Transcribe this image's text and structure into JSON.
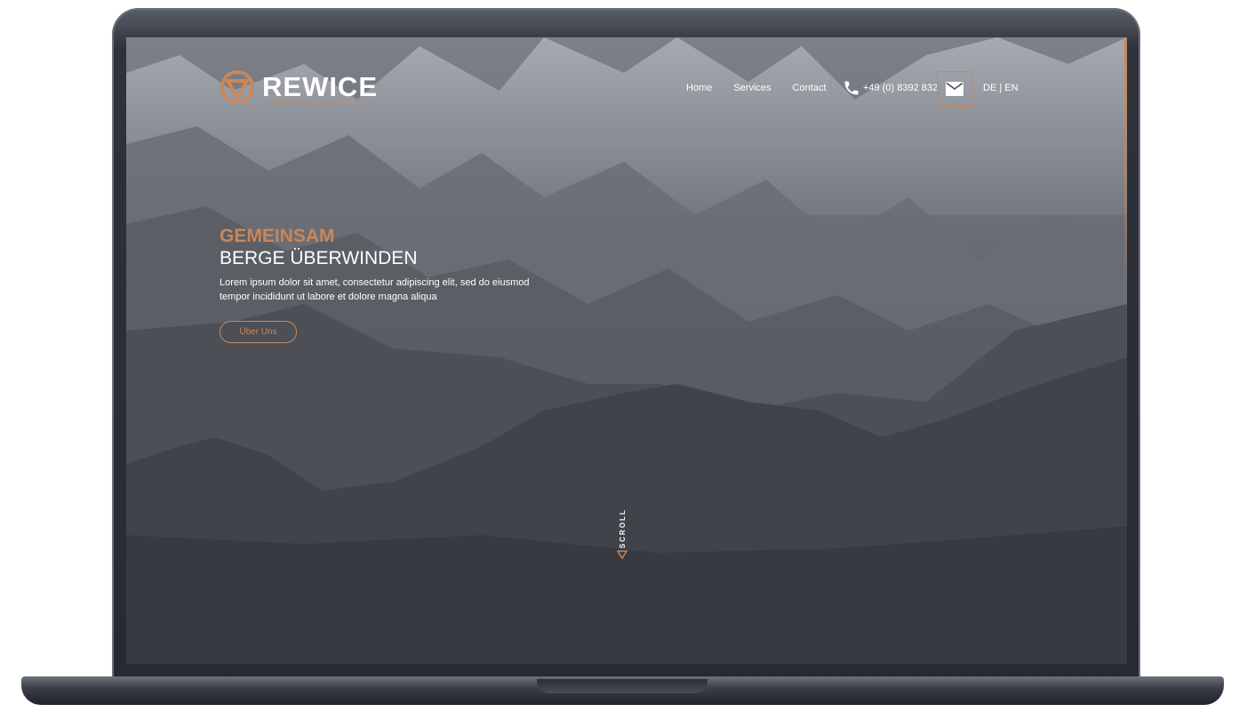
{
  "brand": {
    "name": "REWICE",
    "tagline": "ALWAYS CHANGE YOUR PERSPECTIVE",
    "accent_color": "#c9875a"
  },
  "nav": {
    "items": [
      {
        "label": "Home"
      },
      {
        "label": "Services"
      },
      {
        "label": "Contact"
      }
    ]
  },
  "contact": {
    "phone": "+49 (0) 8392 832",
    "phone_icon": "phone-icon",
    "mail_icon": "mail-icon"
  },
  "language": {
    "label": "DE | EN"
  },
  "hero": {
    "title_highlight": "GEMEINSAM",
    "title": "BERGE ÜBERWINDEN",
    "text": "Lorem ipsum dolor sit amet, consectetur adipiscing elit, sed do eiusmod tempor incididunt ut labore et dolore magna aliqua",
    "button_label": "Über Uns"
  },
  "scroll": {
    "label": "SCROLL",
    "icon": "triangle-down-icon"
  }
}
